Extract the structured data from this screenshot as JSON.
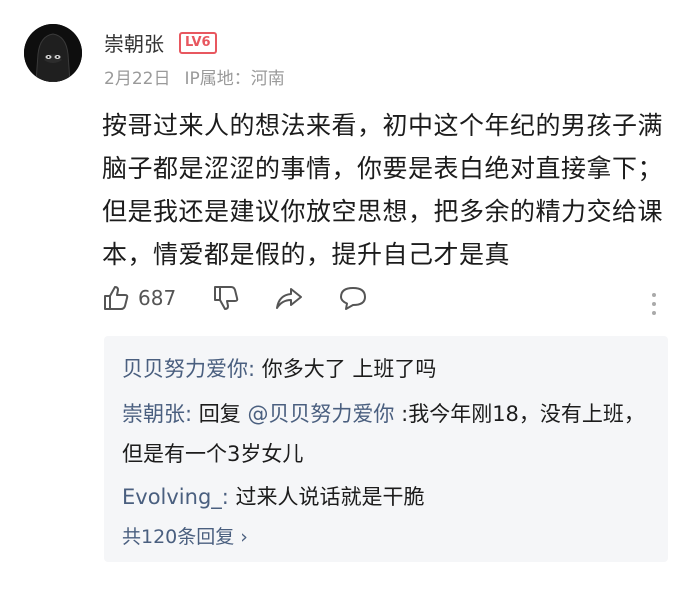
{
  "comment": {
    "username": "崇朝张",
    "level": "LV6",
    "date": "2月22日",
    "location": "IP属地：河南",
    "text": "按哥过来人的想法来看，初中这个年纪的男孩子满脑子都是涩涩的事情，你要是表白绝对直接拿下；但是我还是建议你放空思想，把多余的精力交给课本，情爱都是假的，提升自己才是真",
    "like_count": "687"
  },
  "replies": [
    {
      "nick": "贝贝努力爱你:",
      "text": " 你多大了 上班了吗"
    },
    {
      "nick": "崇朝张:",
      "prefix": " 回复 ",
      "mention": "@贝贝努力爱你",
      "text": " :我今年刚18，没有上班，但是有一个3岁女儿"
    },
    {
      "nick": "Evolving_:",
      "text": " 过来人说话就是干脆"
    }
  ],
  "more_replies_label": "共120条回复 ›",
  "colors": {
    "link": "#4a5f7f",
    "badge": "#e8575f",
    "meta": "#9a9a9a",
    "reply_bg": "#f5f6f8"
  },
  "icons": [
    "avatar-hooded-figure",
    "thumbs-up-icon",
    "thumbs-down-icon",
    "share-icon",
    "comment-icon",
    "more-vertical-icon"
  ]
}
